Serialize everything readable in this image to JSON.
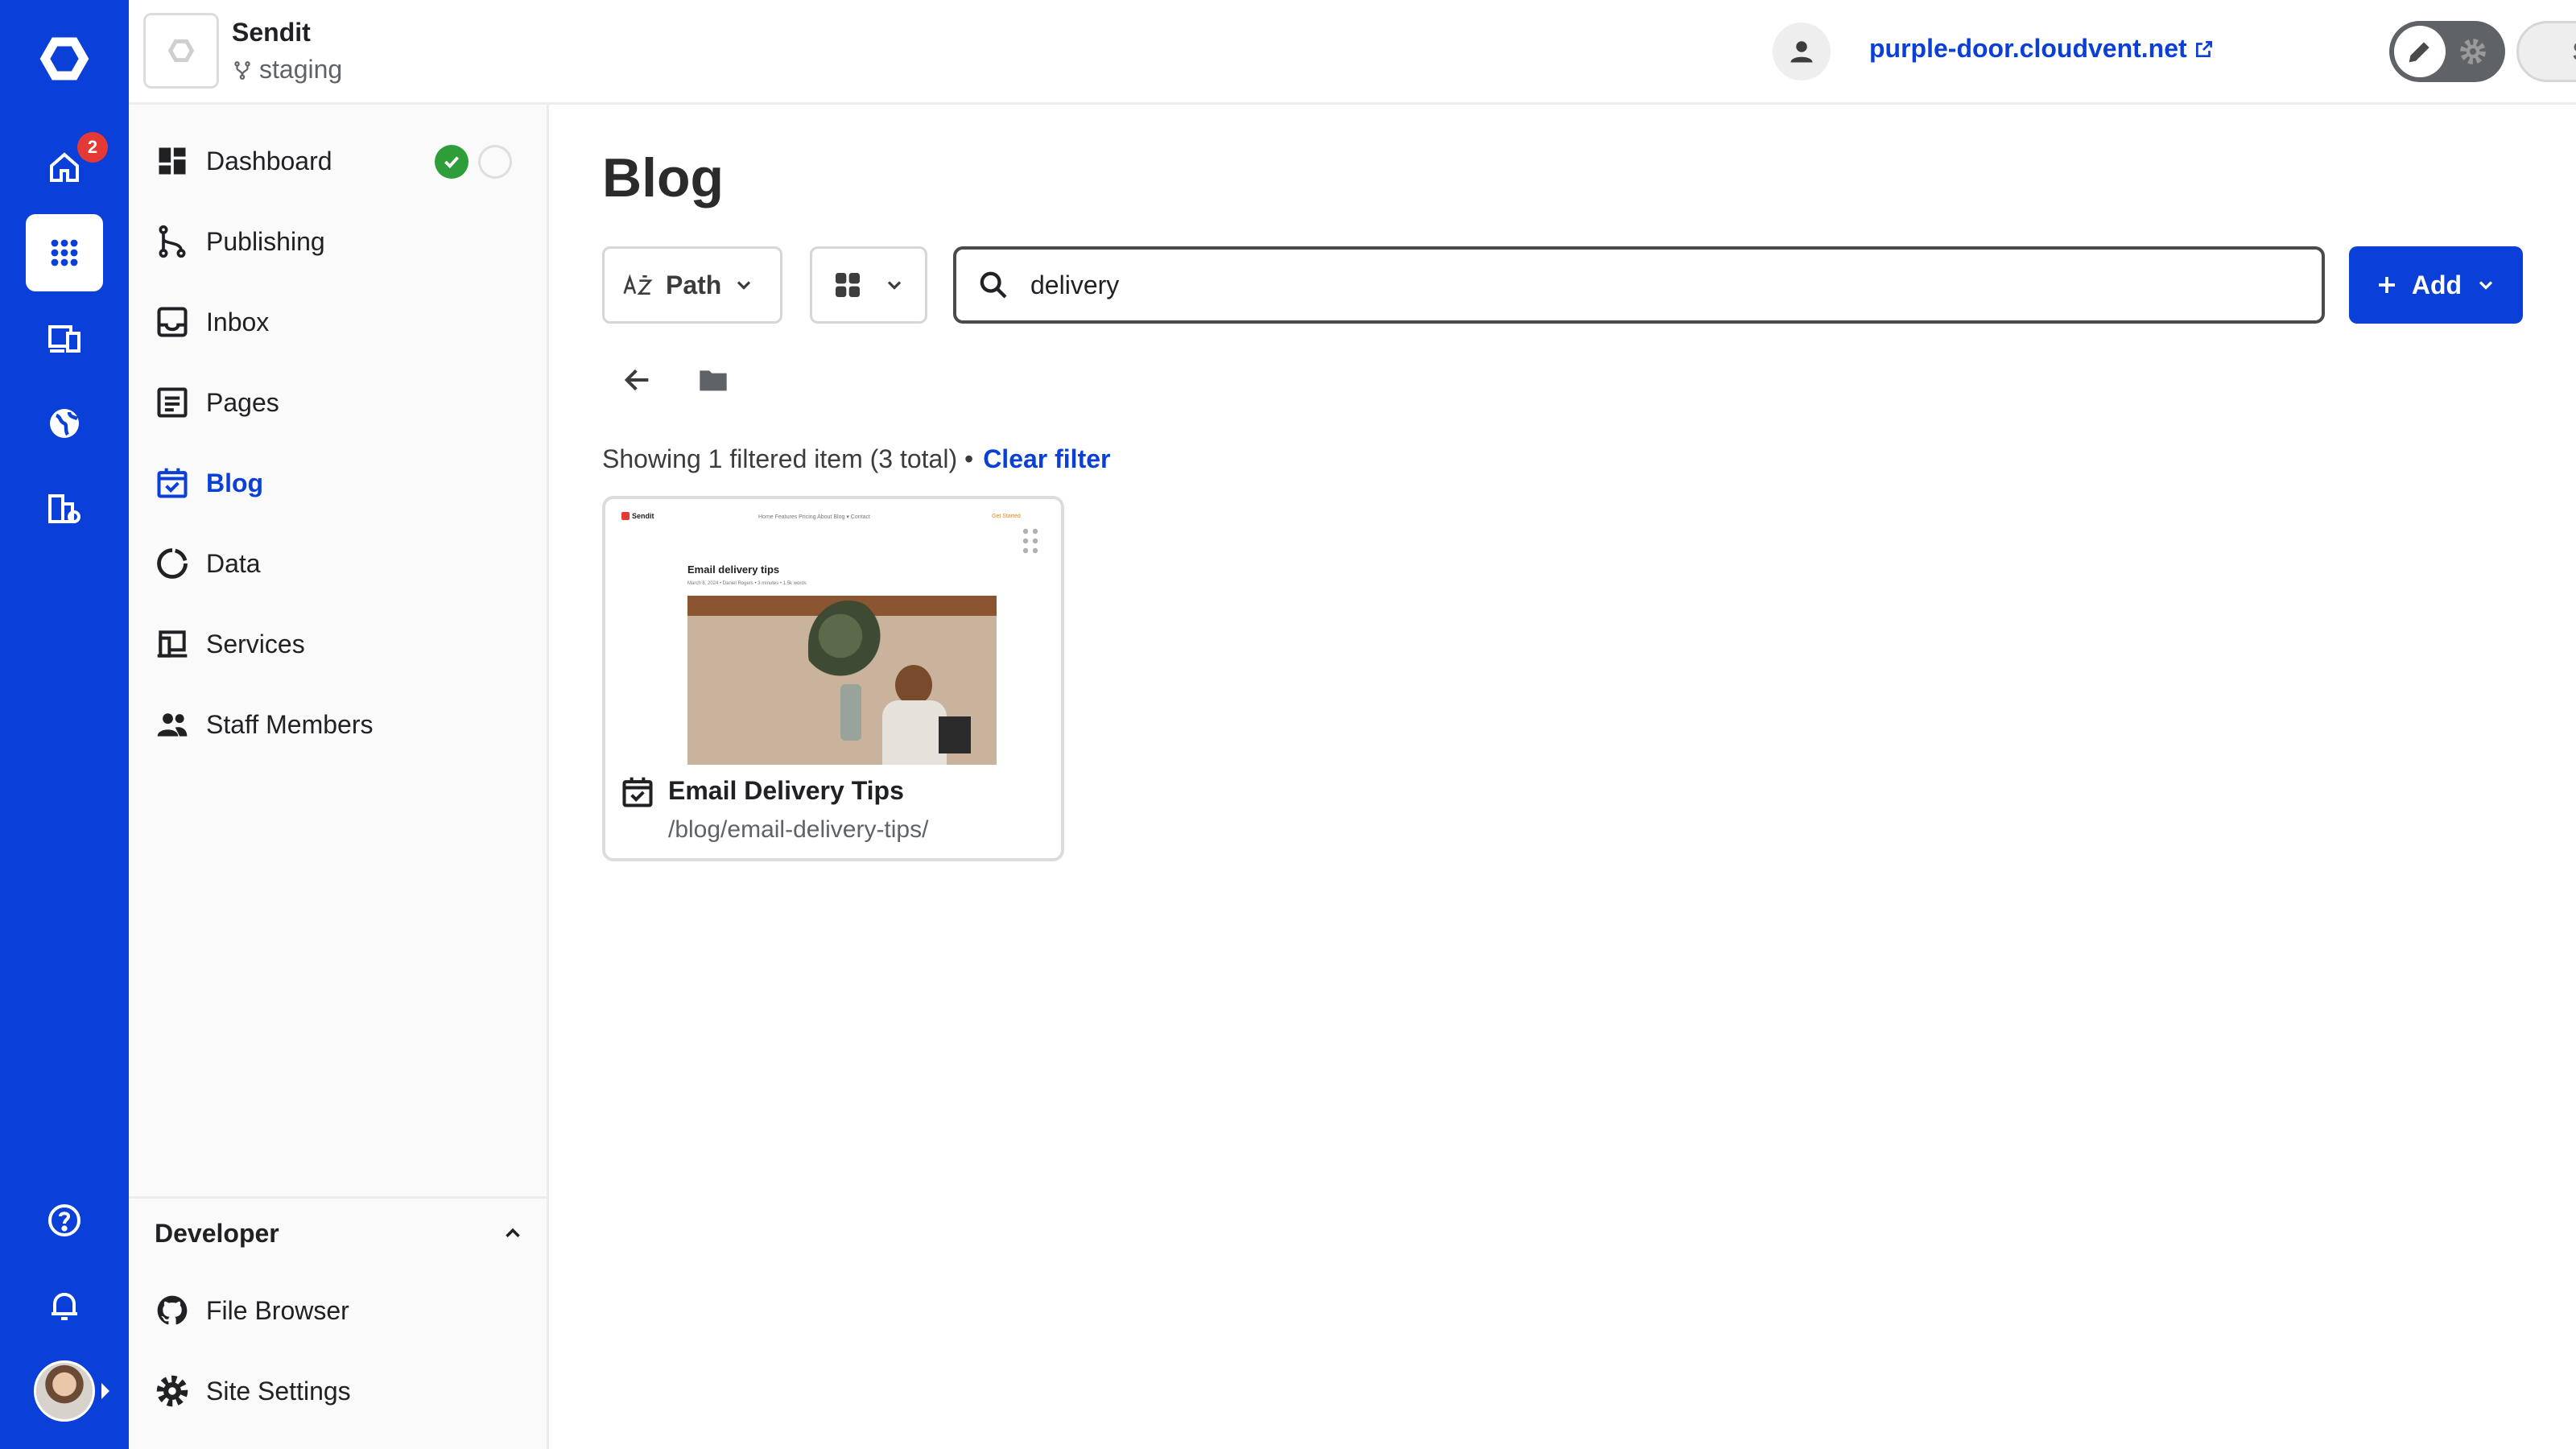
{
  "rail": {
    "home_badge": "2",
    "items": [
      {
        "name": "home-icon"
      },
      {
        "name": "apps-icon",
        "active": true
      },
      {
        "name": "devices-icon"
      },
      {
        "name": "globe-icon"
      },
      {
        "name": "org-settings-icon"
      },
      {
        "name": "help-icon"
      },
      {
        "name": "bell-icon"
      }
    ]
  },
  "header": {
    "site_name": "Sendit",
    "branch": "staging",
    "site_url": "purple-door.cloudvent.net",
    "save_label": "Save"
  },
  "sidebar": {
    "items": [
      {
        "label": "Dashboard",
        "icon": "dashboard-icon"
      },
      {
        "label": "Publishing",
        "icon": "publishing-icon"
      },
      {
        "label": "Inbox",
        "icon": "inbox-icon"
      },
      {
        "label": "Pages",
        "icon": "pages-icon"
      },
      {
        "label": "Blog",
        "icon": "blog-icon",
        "active": true
      },
      {
        "label": "Data",
        "icon": "data-icon"
      },
      {
        "label": "Services",
        "icon": "services-icon"
      },
      {
        "label": "Staff Members",
        "icon": "staff-icon"
      }
    ],
    "developer": {
      "title": "Developer",
      "items": [
        {
          "label": "File Browser",
          "icon": "github-icon"
        },
        {
          "label": "Site Settings",
          "icon": "gear-icon"
        }
      ]
    }
  },
  "main": {
    "title": "Blog",
    "sort_label": "Path",
    "search_value": "delivery",
    "search_placeholder": "",
    "add_label": "Add",
    "filter_status": "Showing 1 filtered item (3 total) •",
    "clear_filter": "Clear filter",
    "cards": [
      {
        "title": "Email Delivery Tips",
        "path": "/blog/email-delivery-tips/",
        "preview": {
          "logo": "Sendit",
          "nav": "Home   Features   Pricing   About   Blog ▾   Contact",
          "signin": "Get Started",
          "title": "Email delivery tips",
          "meta": "March 8, 2024  •  Daniel Rogers  •  3 minutes  •  1.5k words"
        }
      }
    ]
  },
  "colors": {
    "brand": "#0a3fd8",
    "success": "#2e9e3a",
    "badge": "#e53935"
  }
}
